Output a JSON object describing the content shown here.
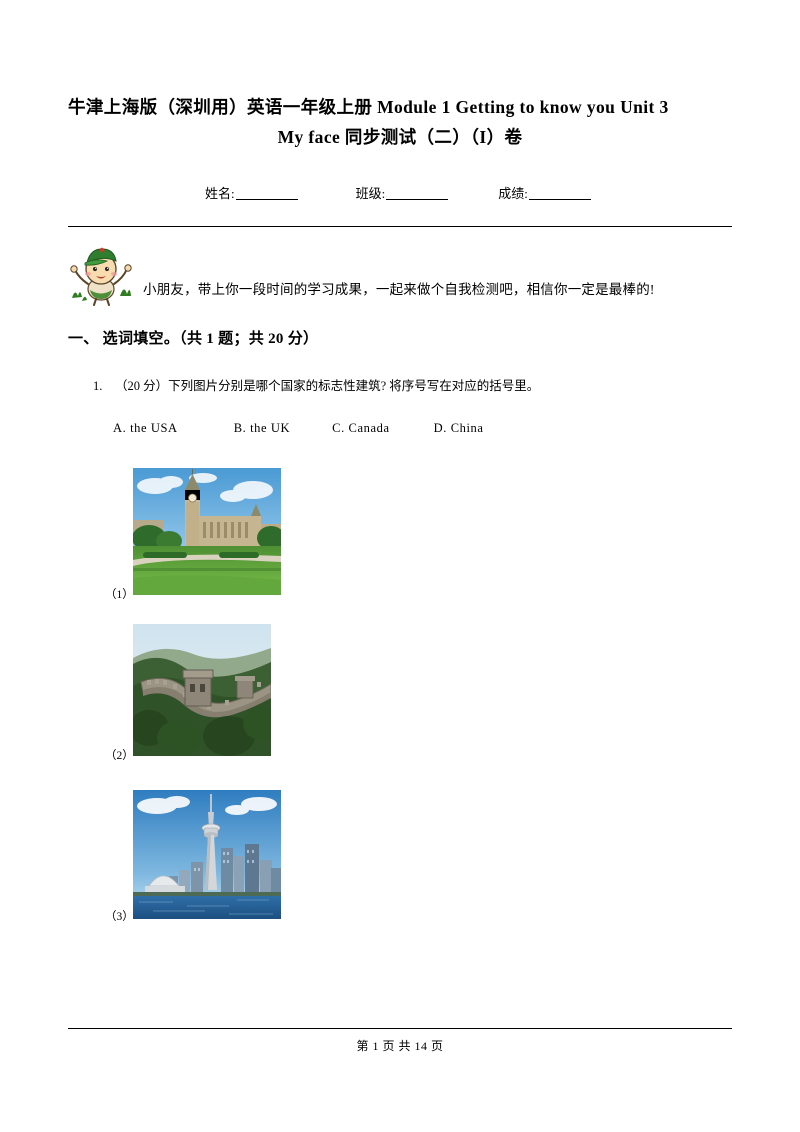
{
  "document": {
    "title_line_1": "牛津上海版（深圳用）英语一年级上册 Module 1 Getting to know you Unit 3",
    "title_line_2": "My face 同步测试（二）（I）卷",
    "fields": [
      {
        "label": "姓名:"
      },
      {
        "label": "班级:"
      },
      {
        "label": "成绩:"
      }
    ],
    "greeting": "小朋友，带上你一段时间的学习成果，一起来做个自我检测吧，相信你一定是最棒的!",
    "section": {
      "heading": "一、 选词填空。（共 1 题；共 20 分）"
    },
    "question": {
      "number": "1.",
      "text": "（20 分）下列图片分别是哪个国家的标志性建筑? 将序号写在对应的括号里。",
      "options": [
        "A. the USA",
        "B. the UK",
        "C. Canada",
        "D. China"
      ],
      "images": [
        {
          "label": "（1）",
          "alt": "big-ben-westminster-photo"
        },
        {
          "label": "（2）",
          "alt": "great-wall-photo"
        },
        {
          "label": "（3）",
          "alt": "cn-tower-toronto-photo"
        }
      ]
    },
    "footer": "第 1 页 共 14 页"
  }
}
